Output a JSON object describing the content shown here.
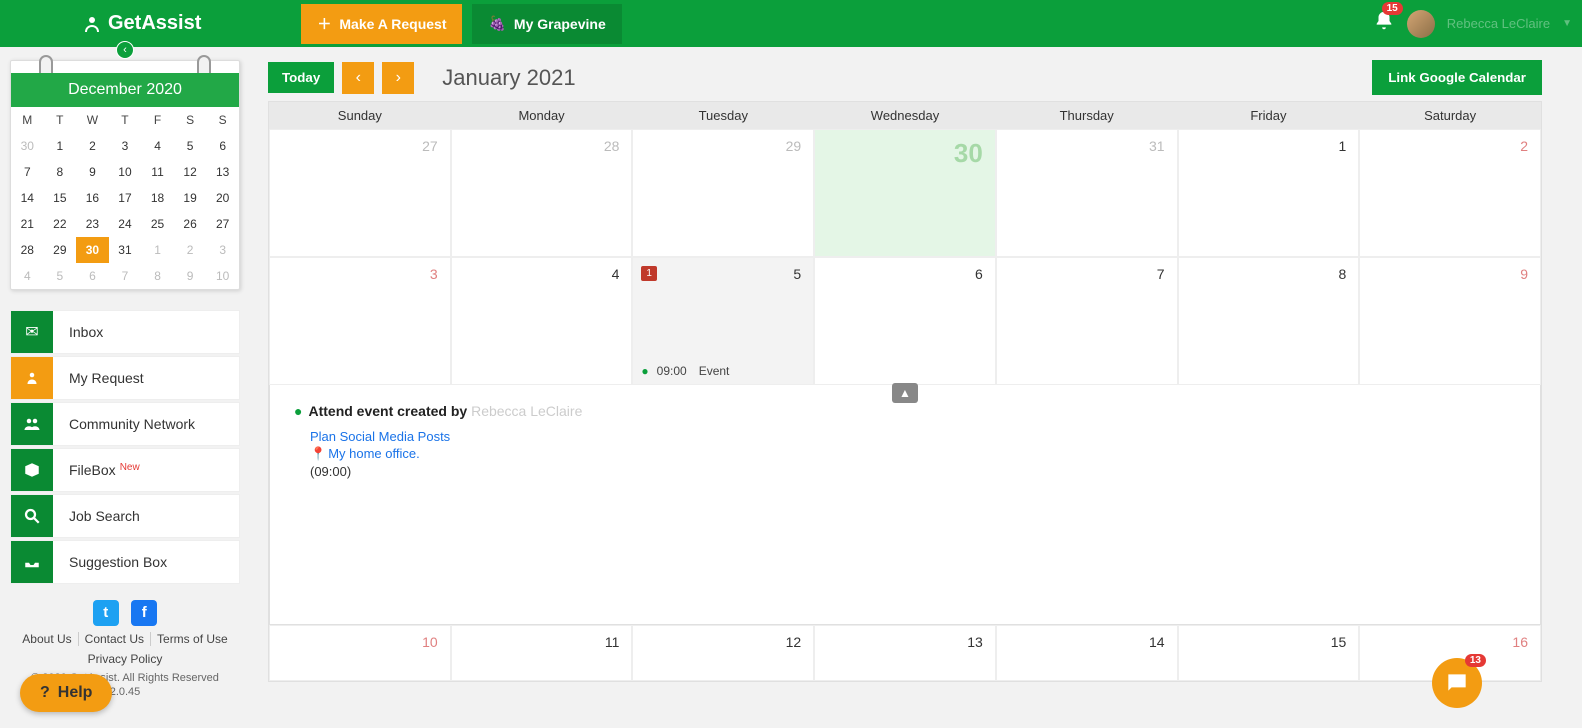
{
  "header": {
    "logo_text": "GetAssist",
    "make_request": "Make A Request",
    "grapevine": "My Grapevine",
    "notif_count": "15",
    "user_name": "Rebecca LeClaire"
  },
  "minical": {
    "title": "December 2020",
    "dow": [
      "M",
      "T",
      "W",
      "T",
      "F",
      "S",
      "S"
    ],
    "rows": [
      [
        {
          "d": "30",
          "o": true
        },
        {
          "d": "1"
        },
        {
          "d": "2"
        },
        {
          "d": "3"
        },
        {
          "d": "4"
        },
        {
          "d": "5"
        },
        {
          "d": "6"
        }
      ],
      [
        {
          "d": "7"
        },
        {
          "d": "8"
        },
        {
          "d": "9"
        },
        {
          "d": "10"
        },
        {
          "d": "11"
        },
        {
          "d": "12"
        },
        {
          "d": "13"
        }
      ],
      [
        {
          "d": "14"
        },
        {
          "d": "15"
        },
        {
          "d": "16"
        },
        {
          "d": "17"
        },
        {
          "d": "18"
        },
        {
          "d": "19"
        },
        {
          "d": "20"
        }
      ],
      [
        {
          "d": "21"
        },
        {
          "d": "22"
        },
        {
          "d": "23"
        },
        {
          "d": "24"
        },
        {
          "d": "25"
        },
        {
          "d": "26"
        },
        {
          "d": "27"
        }
      ],
      [
        {
          "d": "28"
        },
        {
          "d": "29"
        },
        {
          "d": "30",
          "sel": true
        },
        {
          "d": "31"
        },
        {
          "d": "1",
          "o": true
        },
        {
          "d": "2",
          "o": true
        },
        {
          "d": "3",
          "o": true
        }
      ],
      [
        {
          "d": "4",
          "o": true
        },
        {
          "d": "5",
          "o": true
        },
        {
          "d": "6",
          "o": true
        },
        {
          "d": "7",
          "o": true
        },
        {
          "d": "8",
          "o": true
        },
        {
          "d": "9",
          "o": true
        },
        {
          "d": "10",
          "o": true
        }
      ]
    ]
  },
  "nav": {
    "inbox": "Inbox",
    "my_request": "My Request",
    "community": "Community Network",
    "filebox": "FileBox",
    "filebox_new": "New",
    "job_search": "Job Search",
    "suggestion": "Suggestion Box"
  },
  "footer": {
    "about": "About Us",
    "contact": "Contact Us",
    "terms": "Terms of Use",
    "privacy": "Privacy Policy",
    "copyright": "© 2020 GetAssist. All Rights Reserved",
    "version": "2.0.45"
  },
  "help_label": "Help",
  "chat_count": "13",
  "calendar": {
    "today": "Today",
    "title": "January 2021",
    "link_gcal": "Link Google Calendar",
    "dow": [
      "Sunday",
      "Monday",
      "Tuesday",
      "Wednesday",
      "Thursday",
      "Friday",
      "Saturday"
    ],
    "week1": [
      "27",
      "28",
      "29",
      "30",
      "31",
      "1",
      "2"
    ],
    "year_badge": "1",
    "week2": [
      "3",
      "4",
      "5",
      "6",
      "7",
      "8",
      "9"
    ],
    "event_time": "09:00",
    "event_title": "Event",
    "week3": [
      "10",
      "11",
      "12",
      "13",
      "14",
      "15",
      "16"
    ]
  },
  "detail": {
    "prefix": "Attend event created by ",
    "author": "Rebecca LeClaire",
    "link": "Plan Social Media Posts",
    "location": "My home office.",
    "time": "(09:00)"
  }
}
